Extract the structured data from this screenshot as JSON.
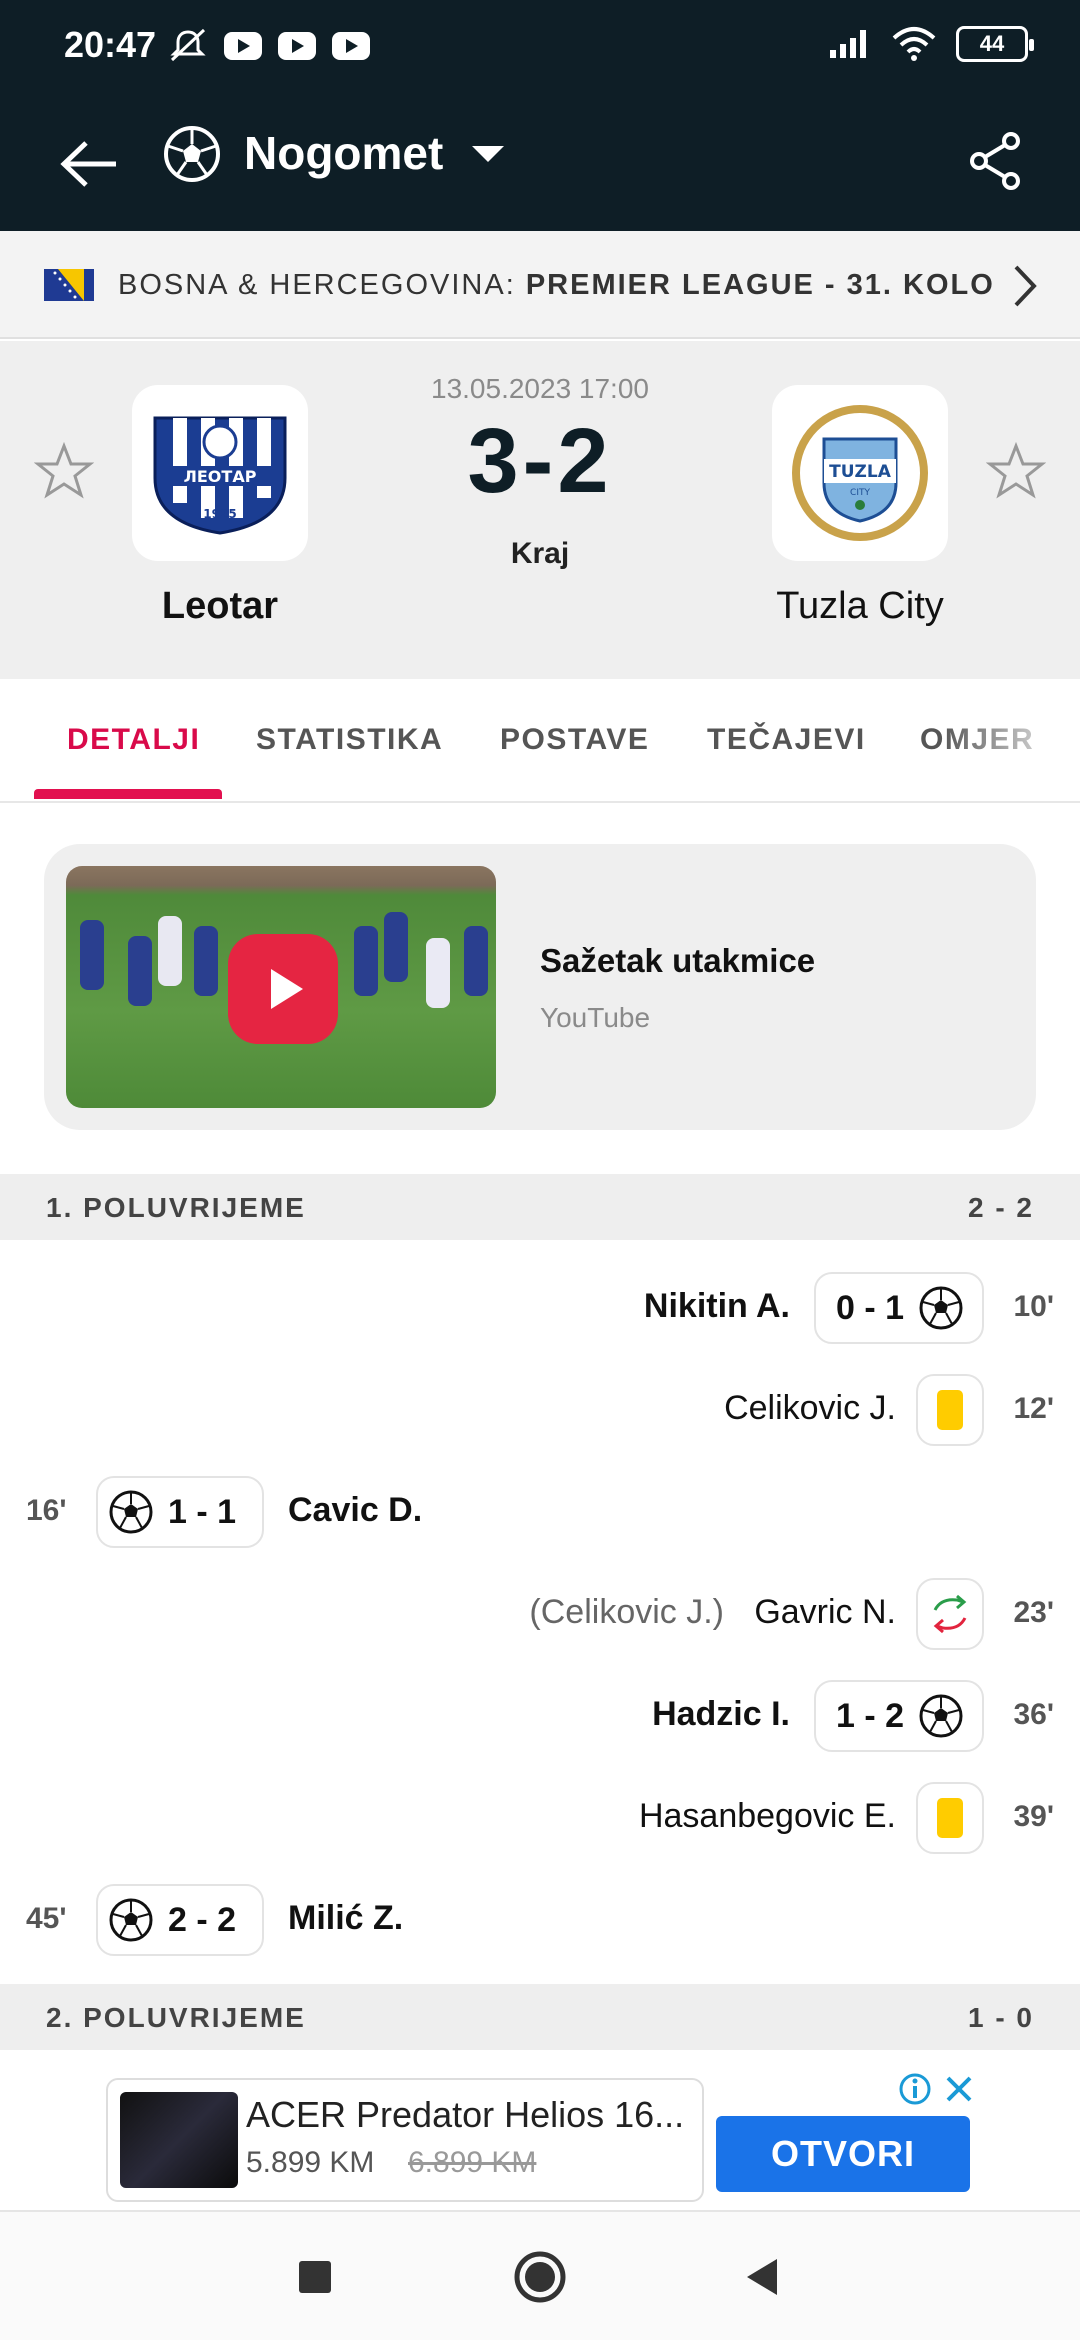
{
  "status_bar": {
    "time": "20:47",
    "battery": "44"
  },
  "app_bar": {
    "title": "Nogomet"
  },
  "league": {
    "country": "BOSNA & HERCEGOVINA:",
    "competition": "PREMIER LEAGUE - 31. KOLO"
  },
  "match": {
    "date": "13.05.2023 17:00",
    "score": "3-2",
    "status": "Kraj",
    "home": {
      "name": "Leotar",
      "logo_text": "ЛЕОТАР",
      "logo_year": "1925"
    },
    "away": {
      "name": "Tuzla City",
      "logo_text": "TUZLA",
      "logo_sub": "CITY"
    }
  },
  "tabs": [
    {
      "label": "DETALJI",
      "active": true
    },
    {
      "label": "STATISTIKA",
      "active": false
    },
    {
      "label": "POSTAVE",
      "active": false
    },
    {
      "label": "TEČAJEVI",
      "active": false
    },
    {
      "label": "OMJER",
      "active": false
    }
  ],
  "highlight": {
    "title": "Sažetak utakmice",
    "source": "YouTube"
  },
  "first_half": {
    "label": "1. POLUVRIJEME",
    "score": "2 - 2",
    "events": [
      {
        "minute": "10'",
        "side": "away",
        "type": "goal",
        "player": "Nikitin A.",
        "score": "0 - 1"
      },
      {
        "minute": "12'",
        "side": "away",
        "type": "yellow-card",
        "player": "Celikovic J."
      },
      {
        "minute": "16'",
        "side": "home",
        "type": "goal",
        "player": "Cavic D.",
        "score": "1 - 1"
      },
      {
        "minute": "23'",
        "side": "away",
        "type": "substitution",
        "player": "Gavric N.",
        "assist": "(Celikovic J.)"
      },
      {
        "minute": "36'",
        "side": "away",
        "type": "goal",
        "player": "Hadzic I.",
        "score": "1 - 2"
      },
      {
        "minute": "39'",
        "side": "away",
        "type": "yellow-card",
        "player": "Hasanbegovic E."
      },
      {
        "minute": "45'",
        "side": "home",
        "type": "goal",
        "player": "Milić Z.",
        "score": "2 - 2"
      }
    ]
  },
  "second_half": {
    "label": "2. POLUVRIJEME",
    "score": "1 - 0"
  },
  "ad": {
    "title": "ACER Predator Helios 16...",
    "price": "5.899 KM",
    "old_price": "6.899 KM",
    "button": "OTVORI"
  },
  "colors": {
    "accent": "#e2104f",
    "header_bg": "#0e1e26",
    "ad_button": "#1a73e8",
    "yellow_card": "#ffcc00"
  }
}
